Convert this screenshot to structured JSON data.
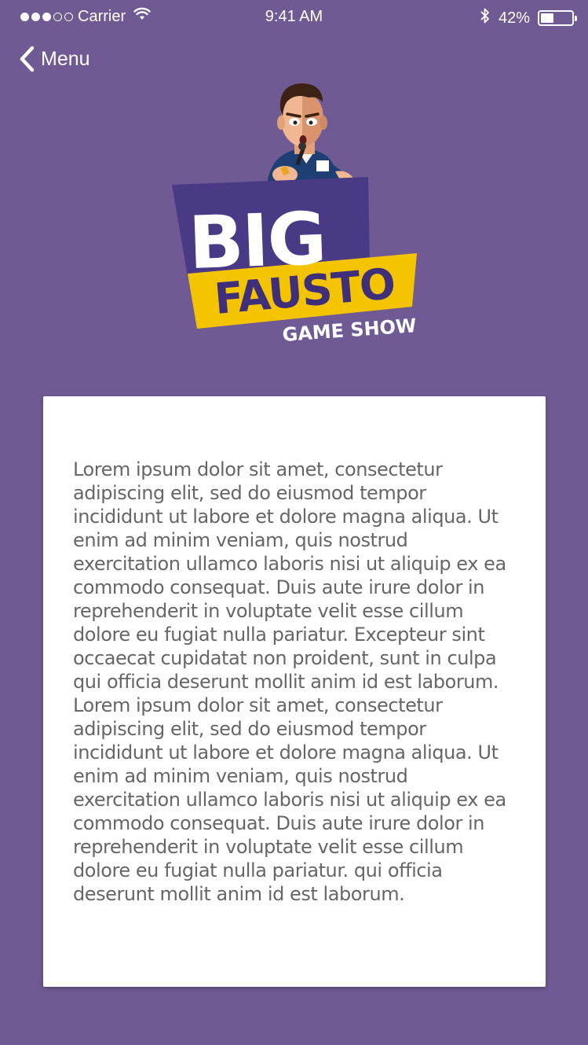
{
  "status_bar": {
    "carrier": "Carrier",
    "time": "9:41 AM",
    "battery_percent_label": "42%",
    "battery_level": 0.42,
    "signal_bars_filled": 3,
    "signal_bars_total": 5
  },
  "nav": {
    "back_label": "Menu"
  },
  "logo": {
    "line1": "BIG",
    "line2": "FAUSTO",
    "line3": "GAME SHOW",
    "colors": {
      "purple_dark": "#4a3a86",
      "yellow": "#f5c400",
      "white": "#ffffff"
    }
  },
  "content": {
    "body": "Lorem ipsum dolor sit amet, consectetur adipiscing elit, sed do eiusmod tempor incididunt ut labore et dolore magna aliqua. Ut enim ad minim veniam, quis nostrud exercitation ullamco laboris nisi ut aliquip ex ea commodo consequat. Duis aute irure dolor in reprehenderit in voluptate velit esse cillum dolore eu fugiat nulla pariatur. Excepteur sint occaecat cupidatat non proident, sunt in culpa qui officia deserunt mollit anim id est laborum. Lorem ipsum dolor sit amet, consectetur adipiscing elit, sed do eiusmod tempor incididunt ut labore et dolore magna aliqua. Ut enim ad minim veniam, quis nostrud exercitation ullamco laboris nisi ut aliquip ex ea commodo consequat. Duis aute irure dolor in reprehenderit in voluptate velit esse cillum dolore eu fugiat nulla pariatur. qui officia deserunt mollit anim id est laborum."
  },
  "theme": {
    "background": "#6f5a93",
    "card": "#ffffff",
    "text": "#666666"
  }
}
